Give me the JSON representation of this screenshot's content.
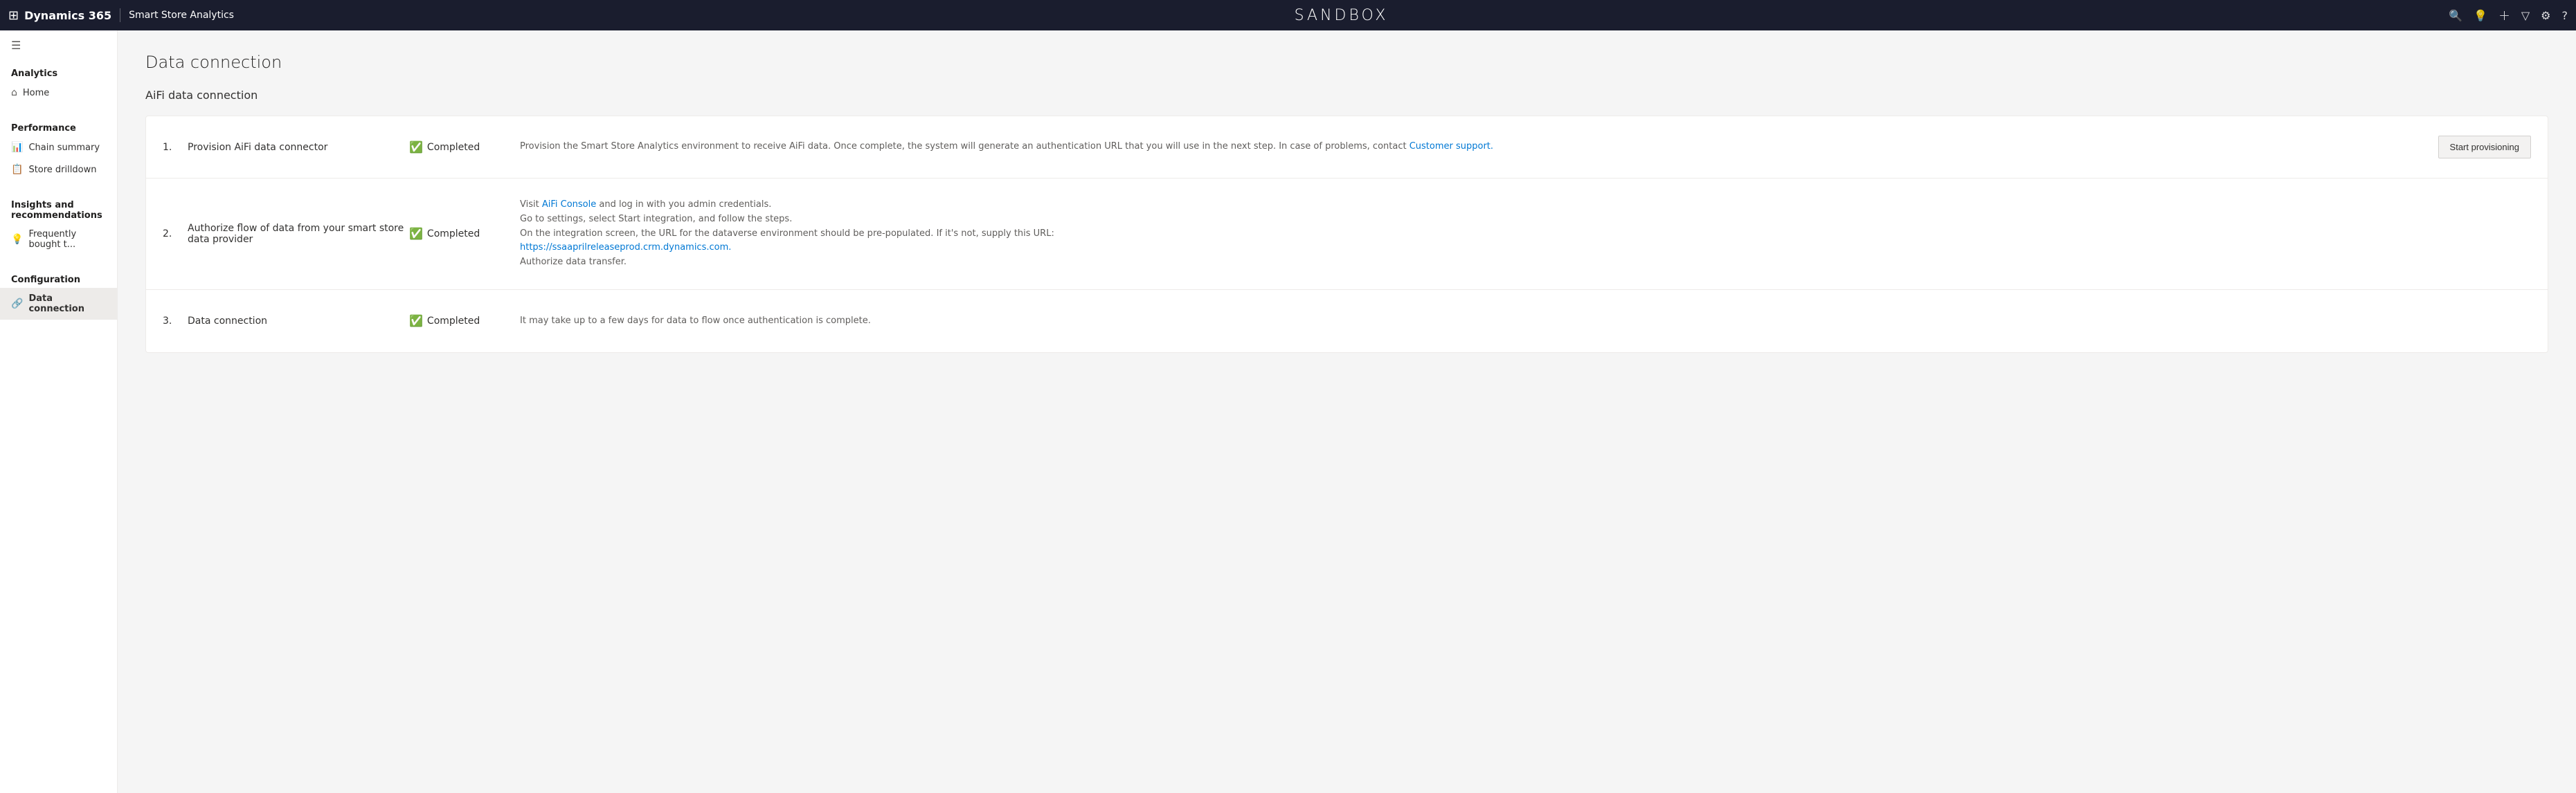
{
  "topnav": {
    "brand": "Dynamics 365",
    "appname": "Smart Store Analytics",
    "sandbox_label": "SANDBOX",
    "icons": {
      "search": "🔍",
      "lightbulb": "💡",
      "plus": "+",
      "funnel": "⚗",
      "settings": "⚙",
      "help": "?"
    }
  },
  "sidebar": {
    "hamburger_icon": "☰",
    "sections": [
      {
        "label": "Analytics",
        "items": [
          {
            "id": "home",
            "label": "Home",
            "icon": "⌂"
          }
        ]
      },
      {
        "label": "Performance",
        "items": [
          {
            "id": "chain-summary",
            "label": "Chain summary",
            "icon": "📊"
          },
          {
            "id": "store-drilldown",
            "label": "Store drilldown",
            "icon": "📋"
          }
        ]
      },
      {
        "label": "Insights and recommendations",
        "items": [
          {
            "id": "frequently-bought",
            "label": "Frequently bought t...",
            "icon": "💡"
          }
        ]
      },
      {
        "label": "Configuration",
        "items": [
          {
            "id": "data-connection",
            "label": "Data connection",
            "icon": "🔗",
            "active": true
          }
        ]
      }
    ]
  },
  "page": {
    "title": "Data connection",
    "subtitle": "AiFi data connection"
  },
  "steps": [
    {
      "number": "1.",
      "name": "Provision AiFi data connector",
      "status": "Completed",
      "description_parts": [
        {
          "type": "text",
          "content": "Provision the Smart Store Analytics environment to receive AiFi data. Once complete, the system will generate an authentication URL that you will use in the next step. In case of problems, contact "
        },
        {
          "type": "link",
          "content": "Customer support.",
          "href": "#"
        },
        {
          "type": "text",
          "content": ""
        }
      ],
      "description_plain": "Provision the Smart Store Analytics environment to receive AiFi data. Once complete, the system will generate an authentication URL that you will use in the next step. In case of problems, contact Customer support.",
      "has_action": true,
      "action_label": "Start provisioning"
    },
    {
      "number": "2.",
      "name": "Authorize flow of data from your smart store data provider",
      "status": "Completed",
      "description_parts": [
        {
          "type": "text",
          "content": "Visit "
        },
        {
          "type": "link",
          "content": "AiFi Console",
          "href": "#"
        },
        {
          "type": "text",
          "content": " and log in with you admin credentials.\nGo to settings, select Start integration, and follow the steps.\nOn the integration screen, the URL for the dataverse environment should be pre-populated. If it's not, supply this URL:\n"
        },
        {
          "type": "link",
          "content": "https://ssaaprilreleaseprod.crm.dynamics.com.",
          "href": "#"
        },
        {
          "type": "text",
          "content": "\nAuthorize data transfer."
        }
      ],
      "has_action": false
    },
    {
      "number": "3.",
      "name": "Data connection",
      "status": "Completed",
      "description_plain": "It may take up to a few days for data to flow once authentication is complete.",
      "has_action": false
    }
  ]
}
